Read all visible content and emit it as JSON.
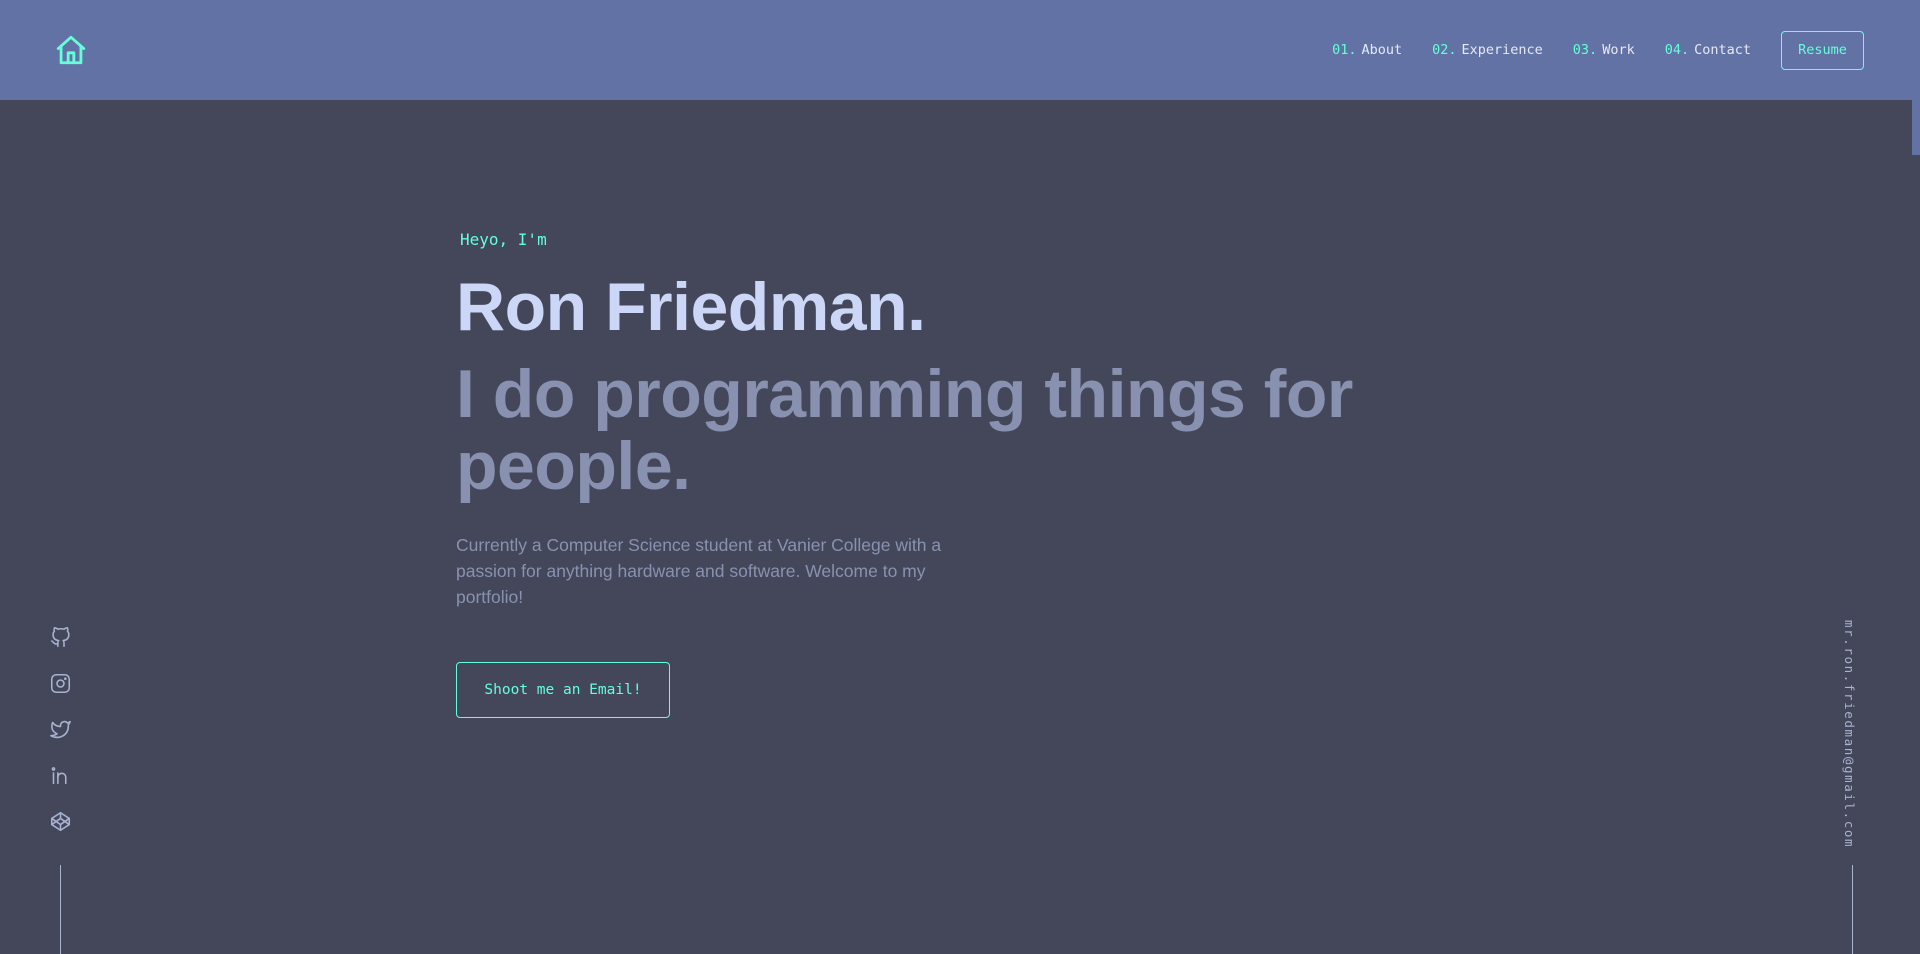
{
  "header": {
    "logo_icon": "home-icon",
    "nav": [
      {
        "num": "01.",
        "label": "About"
      },
      {
        "num": "02.",
        "label": "Experience"
      },
      {
        "num": "03.",
        "label": "Work"
      },
      {
        "num": "04.",
        "label": "Contact"
      }
    ],
    "resume_label": "Resume"
  },
  "hero": {
    "greeting": "Heyo, I'm",
    "name": "Ron Friedman.",
    "tagline": "I do programming things for people.",
    "bio": "Currently a Computer Science student at Vanier College with a passion for anything hardware and software. Welcome to my portfolio!",
    "cta_label": "Shoot me an Email!"
  },
  "socials": [
    "github-icon",
    "instagram-icon",
    "twitter-icon",
    "linkedin-icon",
    "codepen-icon"
  ],
  "side_email": "mr.ron.friedman@gmail.com",
  "colors": {
    "background": "#44475a",
    "header": "#6272a4",
    "accent": "#64ffda",
    "heading": "#ccd6f6",
    "muted": "#8892b0"
  }
}
